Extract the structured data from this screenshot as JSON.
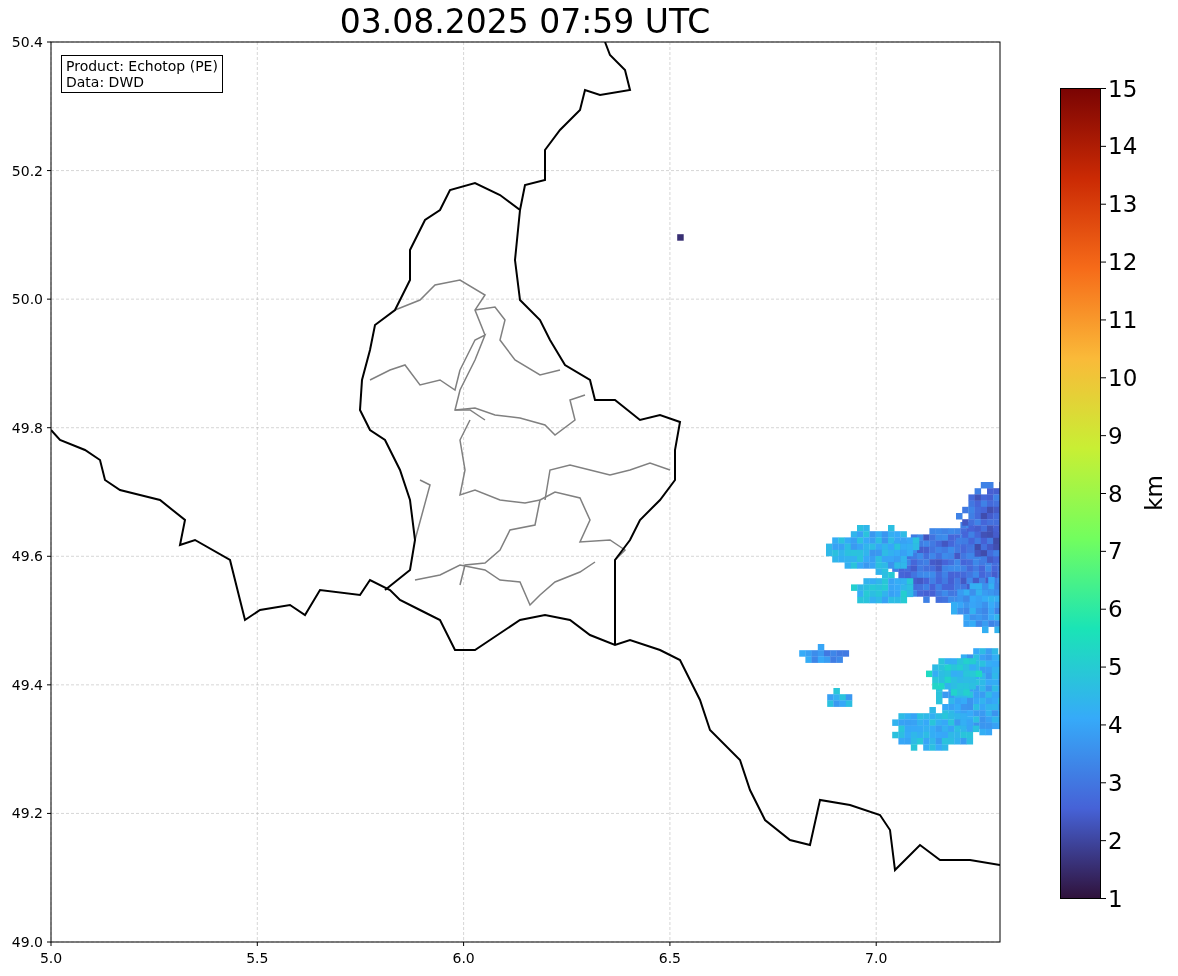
{
  "title": "03.08.2025 07:59 UTC",
  "info_box": [
    "Product: Echotop (PE)",
    "Data: DWD"
  ],
  "map": {
    "x_ticks": [
      "5.0",
      "5.5",
      "6.0",
      "6.5",
      "7.0"
    ],
    "y_ticks": [
      "50.4",
      "50.2",
      "50.0",
      "49.8",
      "49.6",
      "49.4",
      "49.2",
      "49.0"
    ]
  },
  "colorbar": {
    "label": "km",
    "ticks": [
      "15",
      "14",
      "13",
      "12",
      "11",
      "10",
      "9",
      "8",
      "7",
      "6",
      "5",
      "4",
      "3",
      "2",
      "1"
    ]
  }
}
